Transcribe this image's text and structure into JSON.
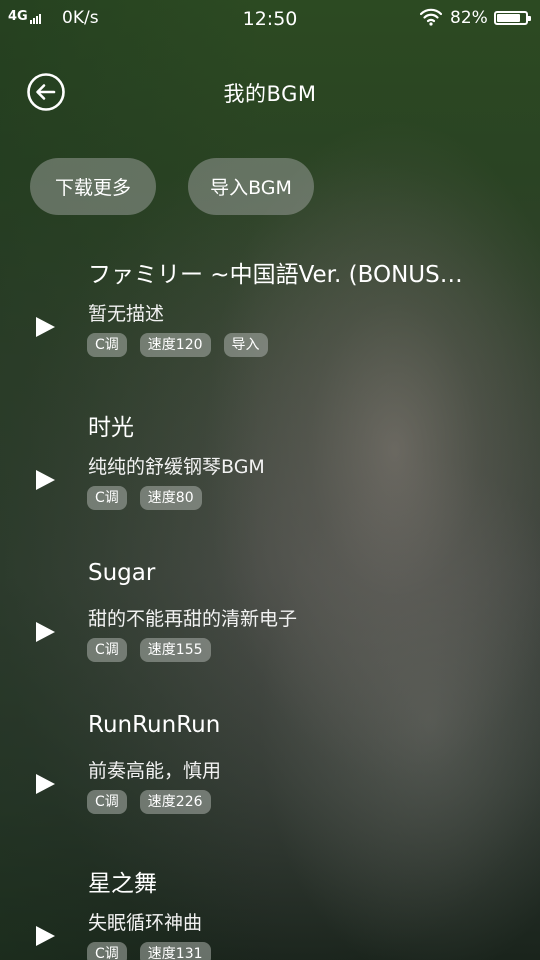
{
  "status_bar": {
    "network_type": "4G",
    "network_speed": "0K/s",
    "time": "12:50",
    "wifi_icon": "wifi-icon",
    "battery_percent": "82%",
    "battery_level": 0.82
  },
  "header": {
    "back_icon": "arrow-left-circle-icon",
    "title": "我的BGM"
  },
  "actions": {
    "download_more": "下载更多",
    "import_bgm": "导入BGM"
  },
  "songs": [
    {
      "title": "ファミリー ~中国語Ver. (BONUS…",
      "description": "暂无描述",
      "tags": [
        "C调",
        "速度120",
        "导入"
      ]
    },
    {
      "title": "时光",
      "description": "纯纯的舒缓钢琴BGM",
      "tags": [
        "C调",
        "速度80"
      ]
    },
    {
      "title": "Sugar",
      "description": "甜的不能再甜的清新电子",
      "tags": [
        "C调",
        "速度155"
      ]
    },
    {
      "title": "RunRunRun",
      "description": "前奏高能，慎用",
      "tags": [
        "C调",
        "速度226"
      ]
    },
    {
      "title": "星之舞",
      "description": "失眠循环神曲",
      "tags": [
        "C调",
        "速度131"
      ]
    }
  ],
  "colors": {
    "background_top": "#2c4a22",
    "background_bottom": "#1a241c",
    "text": "#ffffff",
    "pill_bg": "rgba(150,155,150,0.55)",
    "tag_bg": "rgba(170,175,170,0.55)"
  }
}
